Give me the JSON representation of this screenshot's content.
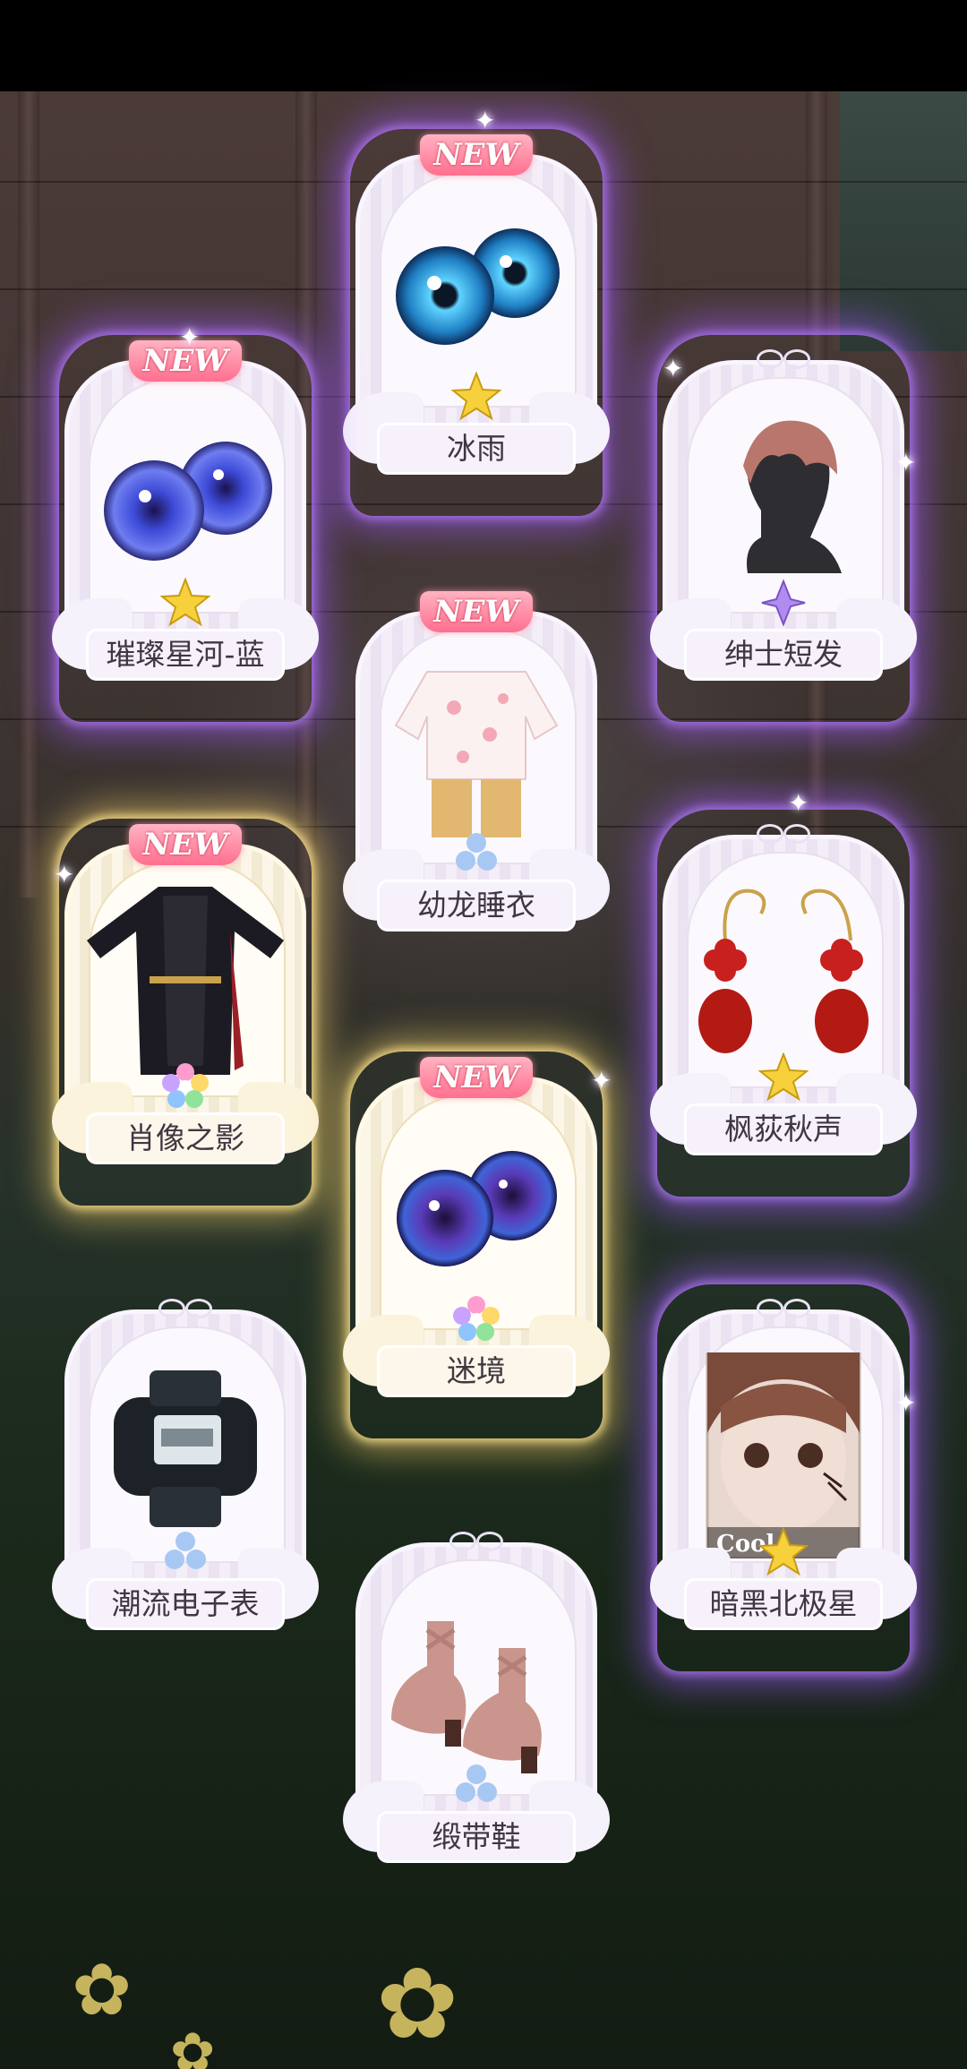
{
  "cards": [
    {
      "label": "冰雨",
      "is_new": true,
      "new_text": "NEW",
      "glow": "purple",
      "item_icon": "blue-eyes-icon",
      "rarity_icon": "gold-star-flower-icon"
    },
    {
      "label": "璀璨星河-蓝",
      "is_new": true,
      "new_text": "NEW",
      "glow": "purple",
      "item_icon": "galaxy-blue-eyes-icon",
      "rarity_icon": "gold-star-flower-icon"
    },
    {
      "label": "绅士短发",
      "is_new": false,
      "glow": "purple",
      "item_icon": "short-hair-icon",
      "rarity_icon": "purple-flower-icon"
    },
    {
      "label": "幼龙睡衣",
      "is_new": true,
      "new_text": "NEW",
      "glow": "plain",
      "item_icon": "pajama-outfit-icon",
      "rarity_icon": "blue-flower-icon"
    },
    {
      "label": "肖像之影",
      "is_new": true,
      "new_text": "NEW",
      "glow": "gold",
      "item_icon": "military-coat-outfit-icon",
      "rarity_icon": "rainbow-flower-icon"
    },
    {
      "label": "枫荻秋声",
      "is_new": false,
      "glow": "purple",
      "item_icon": "red-earrings-icon",
      "rarity_icon": "gold-star-flower-icon"
    },
    {
      "label": "迷境",
      "is_new": true,
      "new_text": "NEW",
      "glow": "gold",
      "item_icon": "galaxy-purple-eyes-icon",
      "rarity_icon": "rainbow-flower-icon"
    },
    {
      "label": "潮流电子表",
      "is_new": false,
      "glow": "plain",
      "item_icon": "digital-watch-icon",
      "rarity_icon": "blue-flower-icon"
    },
    {
      "label": "暗黑北极星",
      "is_new": false,
      "glow": "purple",
      "item_icon": "makeup-portrait-icon",
      "portrait_text": "Cool",
      "rarity_icon": "gold-star-flower-icon"
    },
    {
      "label": "缎带鞋",
      "is_new": false,
      "glow": "plain",
      "item_icon": "ribbon-shoes-icon",
      "rarity_icon": "blue-flower-icon"
    }
  ],
  "colors": {
    "purple_glow": "#a05aff",
    "gold_glow": "#ffd76e",
    "new_badge": "#ff6f8f"
  }
}
